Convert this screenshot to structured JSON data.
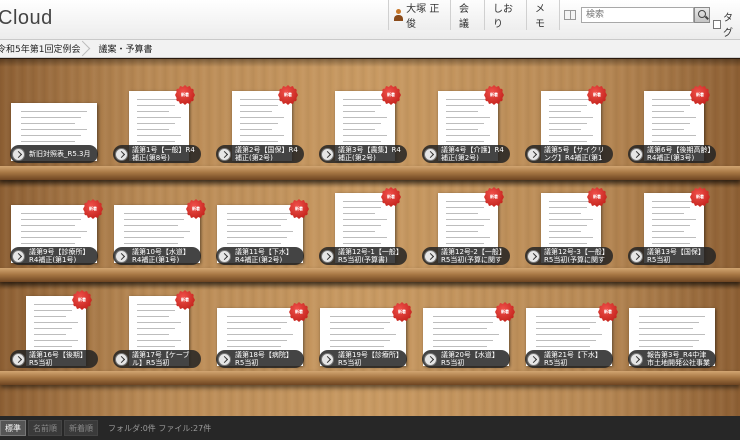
{
  "header": {
    "logo": "Cloud",
    "user_name": "大塚 正俊",
    "nav": [
      "会議",
      "しおり",
      "メモ"
    ],
    "search_placeholder": "検索",
    "tag_label": "タグ"
  },
  "breadcrumb": [
    "令和5年第1回定例会",
    "議案・予算書"
  ],
  "shelves": [
    [
      {
        "label": "新旧対照表_R5.3月",
        "seal": false
      },
      {
        "label": "議第1号【一般】R4補正(第8号)",
        "seal": true
      },
      {
        "label": "議第2号【国保】R4補正(第2号)",
        "seal": true
      },
      {
        "label": "議第3号【農集】R4補正(第2号)",
        "seal": true
      },
      {
        "label": "議第4号【介護】R4補正(第2号)",
        "seal": true
      },
      {
        "label": "議第5号【サイクリング】R4補正(第1号)",
        "seal": true
      },
      {
        "label": "議第6号【後期高齢】R4補正(第3号)",
        "seal": true
      }
    ],
    [
      {
        "label": "議第9号【診療所】R4補正(第1号)",
        "seal": true
      },
      {
        "label": "議第10号【水道】R4補正(第1号)",
        "seal": true
      },
      {
        "label": "議第11号【下水】R4補正(第2号)",
        "seal": true
      },
      {
        "label": "議第12号-1【一般】R5当初(予算書)",
        "seal": true
      },
      {
        "label": "議第12号-2【一般】R5当初(予算に関する",
        "seal": true
      },
      {
        "label": "議第12号-3【一般】R5当初(予算に関する",
        "seal": true
      },
      {
        "label": "議第13号【国保】R5当初",
        "seal": true
      }
    ],
    [
      {
        "label": "議第16号【後期】R5当初",
        "seal": true
      },
      {
        "label": "議第17号【ケーブル】R5当初",
        "seal": true
      },
      {
        "label": "議第18号【病院】R5当初",
        "seal": true
      },
      {
        "label": "議第19号【診療所】R5当初",
        "seal": true
      },
      {
        "label": "議第20号【水道】R5当初",
        "seal": true
      },
      {
        "label": "議第21号【下水】R5当初",
        "seal": true
      },
      {
        "label": "報告第3号_R4中津市土地開発公社事業計画",
        "seal": false
      }
    ]
  ],
  "seal_text": "新着",
  "footer": {
    "sort_options": [
      "標準",
      "名前順",
      "新着順"
    ],
    "active_sort": "標準",
    "info": "フォルダ:0件 ファイル:27件"
  }
}
